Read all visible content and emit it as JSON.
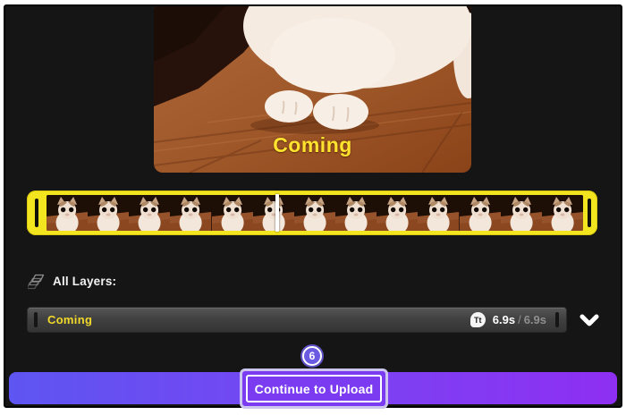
{
  "preview": {
    "caption": "Coming"
  },
  "filmstrip": {
    "frame_count": 13
  },
  "layers_panel": {
    "header_label": "All Layers:",
    "rows": [
      {
        "label": "Coming",
        "type_badge": "Tt",
        "duration_current": "6.9s",
        "duration_separator": "/",
        "duration_total": "6.9s"
      }
    ]
  },
  "annotation": {
    "step_number": "6"
  },
  "footer": {
    "continue_button_label": "Continue to Upload"
  },
  "colors": {
    "timeline_highlight": "#F2E41F",
    "caption_yellow": "#FFE32E",
    "layer_label_yellow": "#F2D92A",
    "footer_gradient_start": "#5E55F2",
    "footer_gradient_end": "#8E2FF2",
    "step_badge_purple": "#6A5BE2",
    "annotation_border": "#CCC6EE"
  }
}
